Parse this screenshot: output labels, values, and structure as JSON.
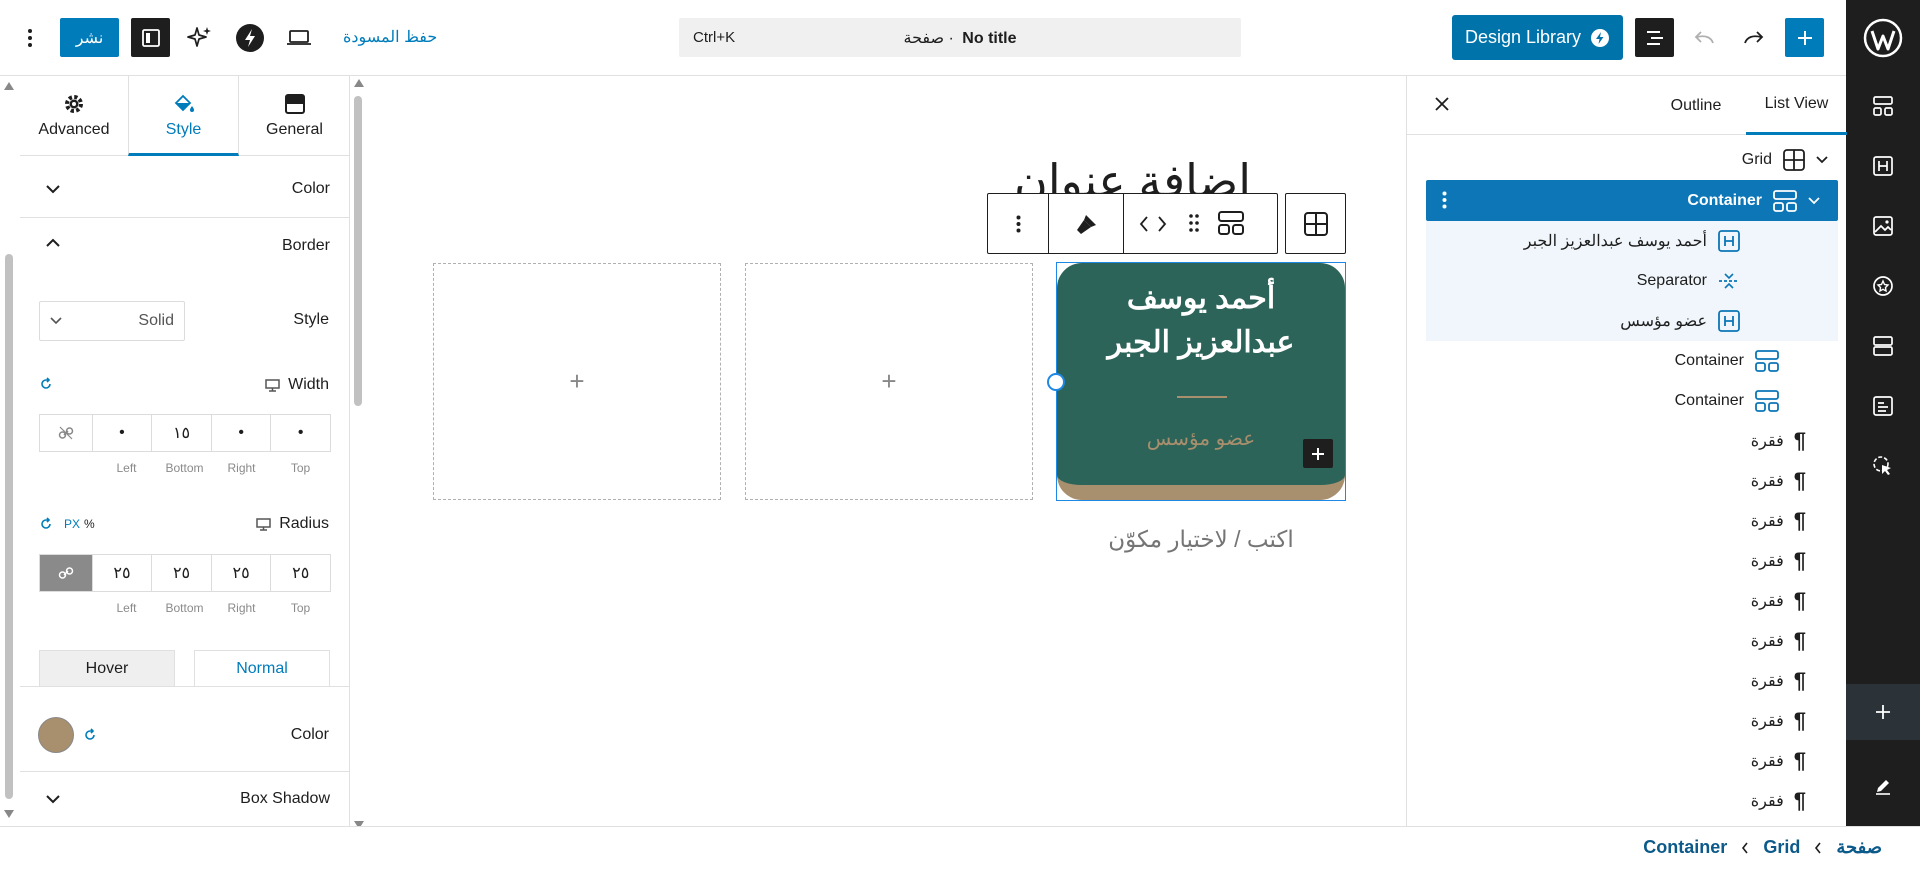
{
  "topbar": {
    "draft_label": "حفظ المسودة",
    "publish_label": "نشر",
    "doc_title": "No title",
    "doc_type": "· صفحة",
    "shortcut": "Ctrl+K",
    "design_library_label": "Design Library"
  },
  "left_panel": {
    "tabs": [
      {
        "label": "Advanced",
        "icon": "gear-icon"
      },
      {
        "label": "Style",
        "icon": "paint-drop-icon",
        "active": true
      },
      {
        "label": "General",
        "icon": "layout-icon"
      }
    ],
    "color_section": "Color",
    "border_section": "Border",
    "style_label": "Style",
    "style_value": "Solid",
    "width_label": "Width",
    "width_values": [
      "•",
      "•",
      "١٥",
      "•"
    ],
    "side_labels": [
      "Top",
      "Right",
      "Bottom",
      "Left"
    ],
    "radius_label": "Radius",
    "units": [
      "PX",
      "%"
    ],
    "radius_values": [
      "٢٥",
      "٢٥",
      "٢٥",
      "٢٥"
    ],
    "state_tabs": {
      "normal": "Normal",
      "hover": "Hover"
    },
    "border_color_label": "Color",
    "border_color": "#a88f6d",
    "box_shadow_section": "Box Shadow"
  },
  "canvas": {
    "page_title_placeholder": "إضافة عنوان",
    "card_name": "أحمد يوسف عبدالعزيز الجبر",
    "card_role": "عضو مؤسس",
    "card_bg": "#2d6459",
    "card_border": "#a88f6d",
    "prompt_text": "اكتب / لاختيار مكوّن",
    "empty_cell_icon": "+"
  },
  "list_panel": {
    "tabs": [
      "List View",
      "Outline"
    ],
    "active_tab": "List View",
    "items": [
      {
        "label": "Grid",
        "icon": "grid-icon",
        "level": 0
      },
      {
        "label": "Container",
        "icon": "container-icon",
        "level": 1,
        "selected": true
      },
      {
        "label": "أحمد يوسف عبدالعزيز الجبر",
        "icon": "heading-icon",
        "level": 2
      },
      {
        "label": "Separator",
        "icon": "separator-icon",
        "level": 2
      },
      {
        "label": "عضو مؤسس",
        "icon": "heading-icon",
        "level": 2
      },
      {
        "label": "Container",
        "icon": "container-icon",
        "level": 1
      },
      {
        "label": "Container",
        "icon": "container-icon",
        "level": 1
      },
      {
        "label": "فقرة",
        "icon": "paragraph-icon",
        "level": 0
      },
      {
        "label": "فقرة",
        "icon": "paragraph-icon",
        "level": 0
      },
      {
        "label": "فقرة",
        "icon": "paragraph-icon",
        "level": 0
      },
      {
        "label": "فقرة",
        "icon": "paragraph-icon",
        "level": 0
      },
      {
        "label": "فقرة",
        "icon": "paragraph-icon",
        "level": 0
      },
      {
        "label": "فقرة",
        "icon": "paragraph-icon",
        "level": 0
      },
      {
        "label": "فقرة",
        "icon": "paragraph-icon",
        "level": 0
      },
      {
        "label": "فقرة",
        "icon": "paragraph-icon",
        "level": 0
      },
      {
        "label": "فقرة",
        "icon": "paragraph-icon",
        "level": 0
      },
      {
        "label": "فقرة",
        "icon": "paragraph-icon",
        "level": 0
      }
    ]
  },
  "breadcrumb": [
    "صفحة",
    "Grid",
    "Container"
  ],
  "colors": {
    "accent": "#007cba",
    "dark": "#1e1e1e"
  }
}
